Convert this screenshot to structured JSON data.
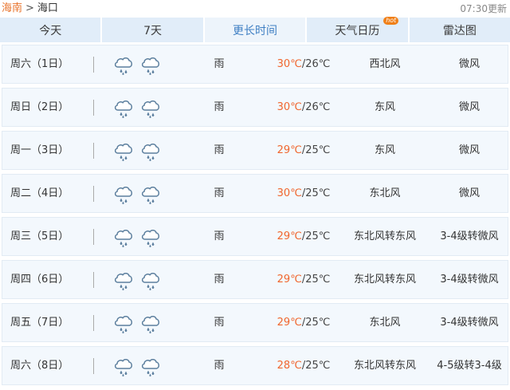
{
  "breadcrumb": {
    "province": "海南",
    "separator": ">",
    "city": "海口"
  },
  "updated": "07:30更新",
  "tabs": [
    {
      "label": "今天",
      "active": false
    },
    {
      "label": "7天",
      "active": false
    },
    {
      "label": "更长时间",
      "active": true
    },
    {
      "label": "天气日历",
      "active": false,
      "badge": "hot"
    },
    {
      "label": "雷达图",
      "active": false
    }
  ],
  "icons": {
    "weather": "cloud-rain-icon"
  },
  "colors": {
    "high_temp": "#f0662e",
    "active_tab": "#3f7fc3",
    "link": "#e8732b"
  },
  "forecast": [
    {
      "day": "周六（1日）",
      "desc": "雨",
      "high": "30℃",
      "low": "/26℃",
      "wind": "西北风",
      "level": "微风"
    },
    {
      "day": "周日（2日）",
      "desc": "雨",
      "high": "30℃",
      "low": "/26℃",
      "wind": "东风",
      "level": "微风"
    },
    {
      "day": "周一（3日）",
      "desc": "雨",
      "high": "29℃",
      "low": "/25℃",
      "wind": "东风",
      "level": "微风"
    },
    {
      "day": "周二（4日）",
      "desc": "雨",
      "high": "30℃",
      "low": "/25℃",
      "wind": "东北风",
      "level": "微风"
    },
    {
      "day": "周三（5日）",
      "desc": "雨",
      "high": "29℃",
      "low": "/25℃",
      "wind": "东北风转东风",
      "level": "3-4级转微风"
    },
    {
      "day": "周四（6日）",
      "desc": "雨",
      "high": "29℃",
      "low": "/25℃",
      "wind": "东北风转东风",
      "level": "3-4级转微风"
    },
    {
      "day": "周五（7日）",
      "desc": "雨",
      "high": "29℃",
      "low": "/25℃",
      "wind": "东北风",
      "level": "3-4级转微风"
    },
    {
      "day": "周六（8日）",
      "desc": "雨",
      "high": "28℃",
      "low": "/25℃",
      "wind": "东北风转东风",
      "level": "4-5级转3-4级"
    }
  ]
}
